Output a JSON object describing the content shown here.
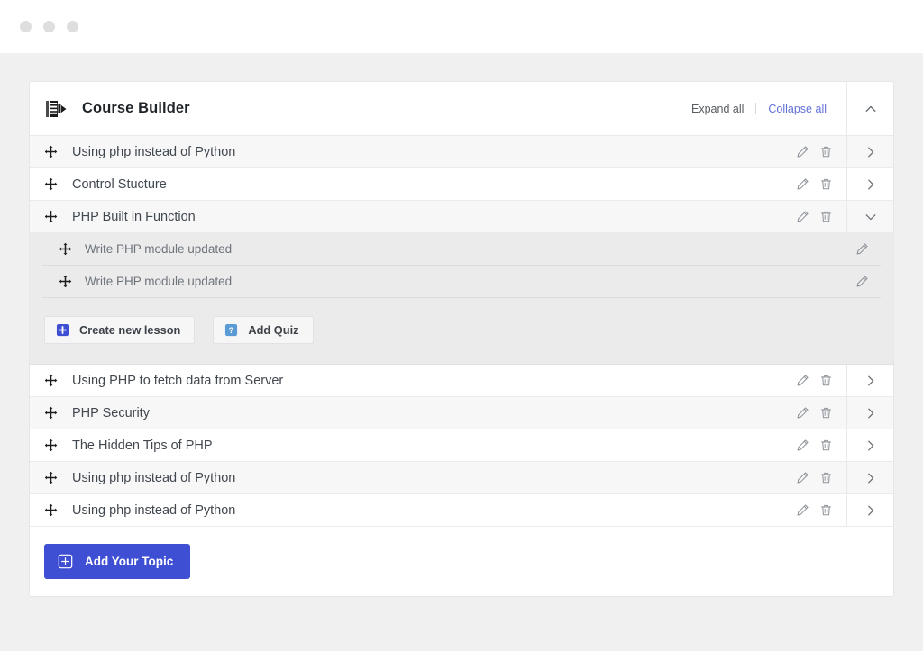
{
  "window": {
    "dots": [
      "dot-1",
      "dot-2",
      "dot-3"
    ]
  },
  "colors": {
    "accent_blue": "#3f4fd4",
    "link_blue": "#6170d8",
    "quiz_blue": "#5b9bd5",
    "row_alt": "#f7f7f8",
    "panel_bg": "#ebebec",
    "page_bg": "#f0f0f1"
  },
  "header": {
    "icon": "course-builder-icon",
    "title": "Course Builder",
    "expand_all": "Expand all",
    "collapse_all": "Collapse all",
    "toggle_icon": "chevron-up-icon"
  },
  "topics": [
    {
      "title": "Using php instead of Python",
      "drag_icon": "drag-handle-icon",
      "edit_icon": "pencil-icon",
      "delete_icon": "trash-icon",
      "toggle_icon": "chevron-right-icon",
      "expanded": false
    },
    {
      "title": "Control Stucture",
      "drag_icon": "drag-handle-icon",
      "edit_icon": "pencil-icon",
      "delete_icon": "trash-icon",
      "toggle_icon": "chevron-right-icon",
      "expanded": false
    },
    {
      "title": "PHP Built in Function",
      "drag_icon": "drag-handle-icon",
      "edit_icon": "pencil-icon",
      "delete_icon": "trash-icon",
      "toggle_icon": "chevron-down-icon",
      "expanded": true
    },
    {
      "title": "Using PHP to fetch data from Server",
      "drag_icon": "drag-handle-icon",
      "edit_icon": "pencil-icon",
      "delete_icon": "trash-icon",
      "toggle_icon": "chevron-right-icon",
      "expanded": false
    },
    {
      "title": "PHP Security",
      "drag_icon": "drag-handle-icon",
      "edit_icon": "pencil-icon",
      "delete_icon": "trash-icon",
      "toggle_icon": "chevron-right-icon",
      "expanded": false
    },
    {
      "title": "The Hidden Tips of PHP",
      "drag_icon": "drag-handle-icon",
      "edit_icon": "pencil-icon",
      "delete_icon": "trash-icon",
      "toggle_icon": "chevron-right-icon",
      "expanded": false
    },
    {
      "title": "Using php instead of Python",
      "drag_icon": "drag-handle-icon",
      "edit_icon": "pencil-icon",
      "delete_icon": "trash-icon",
      "toggle_icon": "chevron-right-icon",
      "expanded": false
    },
    {
      "title": "Using php instead of Python",
      "drag_icon": "drag-handle-icon",
      "edit_icon": "pencil-icon",
      "delete_icon": "trash-icon",
      "toggle_icon": "chevron-right-icon",
      "expanded": false
    }
  ],
  "expanded_panel": {
    "lessons": [
      {
        "title": "Write PHP module updated",
        "drag_icon": "drag-handle-icon",
        "edit_icon": "pencil-icon"
      },
      {
        "title": "Write PHP module updated",
        "drag_icon": "drag-handle-icon",
        "edit_icon": "pencil-icon"
      }
    ],
    "create_lesson_label": "Create new lesson",
    "create_lesson_icon": "plus-square-icon",
    "add_quiz_label": "Add Quiz",
    "add_quiz_icon": "question-square-icon"
  },
  "footer": {
    "add_topic_label": "Add Your Topic",
    "add_topic_icon": "plus-box-icon"
  }
}
